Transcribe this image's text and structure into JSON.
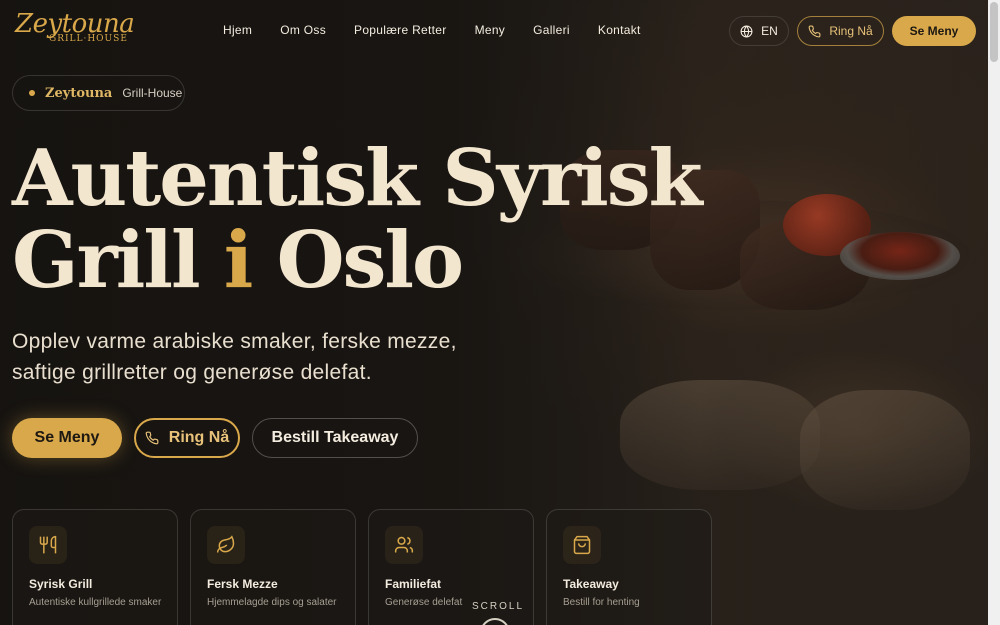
{
  "brand": {
    "name": "Zeytouna",
    "sub": "GRILL·HOUSE"
  },
  "nav": [
    "Hjem",
    "Om Oss",
    "Populære Retter",
    "Meny",
    "Galleri",
    "Kontakt"
  ],
  "header": {
    "lang": "EN",
    "call": "Ring Nå",
    "menu": "Se Meny"
  },
  "badge": {
    "name": "Zeytouna",
    "tag": "Grill-House"
  },
  "hero": {
    "line1": "Autentisk Syrisk",
    "line2_a": "Grill",
    "line2_b": "i",
    "line2_c": "Oslo",
    "lead": "Opplev varme arabiske smaker, ferske mezze, saftige grillretter og generøse delefat."
  },
  "cta": {
    "primary": "Se Meny",
    "call": "Ring Nå",
    "takeaway": "Bestill Takeaway"
  },
  "features": [
    {
      "icon": "utensils-icon",
      "title": "Syrisk Grill",
      "sub": "Autentiske kullgrillede smaker"
    },
    {
      "icon": "leaf-icon",
      "title": "Fersk Mezze",
      "sub": "Hjemmelagde dips og salater"
    },
    {
      "icon": "users-icon",
      "title": "Familiefat",
      "sub": "Generøse delefat"
    },
    {
      "icon": "shopping-bag-icon",
      "title": "Takeaway",
      "sub": "Bestill for henting"
    }
  ],
  "scroll_label": "SCROLL",
  "colors": {
    "accent": "#d9a84a",
    "background": "#1a1714",
    "text": "#f3ecdf"
  }
}
